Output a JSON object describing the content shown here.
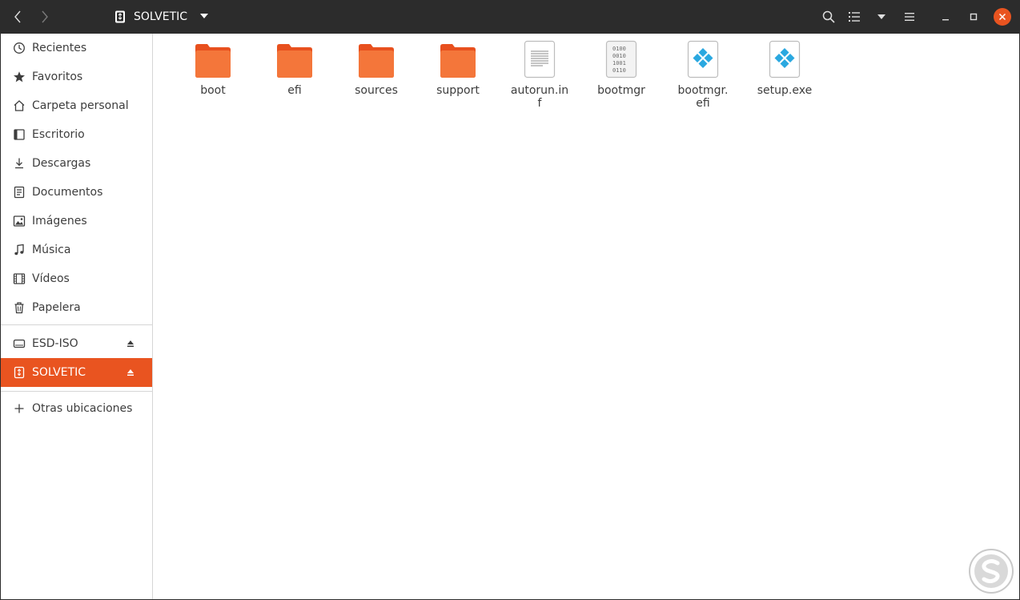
{
  "header": {
    "location": "SOLVETIC",
    "icons": {
      "back": "chevron-left-icon",
      "forward": "chevron-right-icon",
      "location": "usb-drive-icon",
      "search": "search-icon",
      "view": "list-view-icon",
      "sort": "caret-down-icon",
      "menu": "hamburger-menu-icon",
      "minimize": "minimize-icon",
      "maximize": "maximize-icon",
      "close": "close-icon"
    }
  },
  "sidebar": {
    "places": [
      {
        "label": "Recientes",
        "icon": "clock-icon"
      },
      {
        "label": "Favoritos",
        "icon": "star-icon"
      },
      {
        "label": "Carpeta personal",
        "icon": "home-icon"
      },
      {
        "label": "Escritorio",
        "icon": "desktop-icon"
      },
      {
        "label": "Descargas",
        "icon": "download-icon"
      },
      {
        "label": "Documentos",
        "icon": "document-icon"
      },
      {
        "label": "Imágenes",
        "icon": "image-icon"
      },
      {
        "label": "Música",
        "icon": "music-icon"
      },
      {
        "label": "Vídeos",
        "icon": "video-icon"
      },
      {
        "label": "Papelera",
        "icon": "trash-icon"
      }
    ],
    "devices": [
      {
        "label": "ESD-ISO",
        "icon": "drive-icon",
        "active": false
      },
      {
        "label": "SOLVETIC",
        "icon": "usb-drive-icon",
        "active": true
      }
    ],
    "other_locations": "Otras ubicaciones"
  },
  "files": [
    {
      "name": "boot",
      "type": "folder"
    },
    {
      "name": "efi",
      "type": "folder"
    },
    {
      "name": "sources",
      "type": "folder"
    },
    {
      "name": "support",
      "type": "folder"
    },
    {
      "name": "autorun.inf",
      "type": "text"
    },
    {
      "name": "bootmgr",
      "type": "binary"
    },
    {
      "name": "bootmgr.\nefi",
      "type": "executable"
    },
    {
      "name": "setup.exe",
      "type": "executable"
    }
  ],
  "colors": {
    "accent": "#e95420",
    "header_bg": "#2c2c2c",
    "folder": "#f4763a",
    "exe_diamond": "#2aa8e0"
  }
}
